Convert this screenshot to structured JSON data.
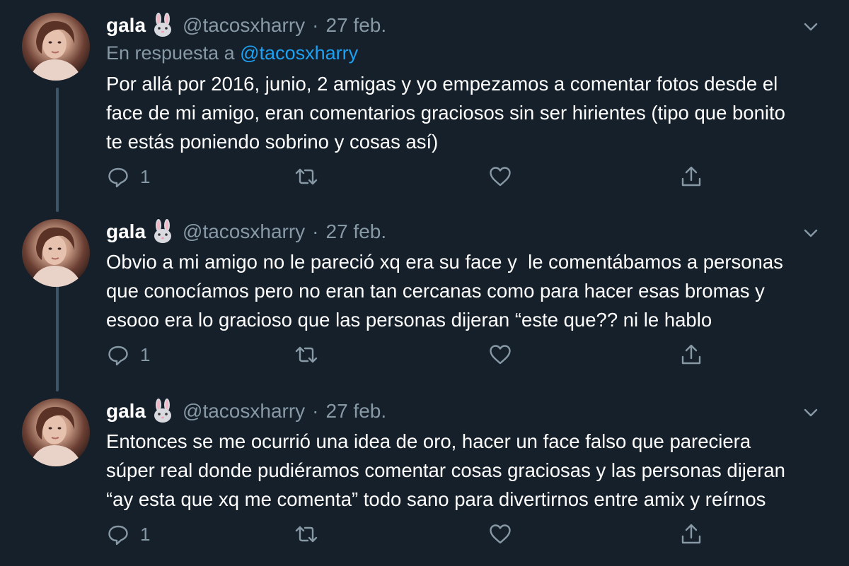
{
  "tweets": [
    {
      "name": "gala",
      "name_emoji": "rabbit-face",
      "handle": "@tacosxharry",
      "separator": "·",
      "date": "27 feb.",
      "reply_prefix": "En respuesta a",
      "reply_mention": "@tacosxharry",
      "text": "Por allá por 2016, junio, 2 amigas y yo empezamos a comentar fotos desde el\nface de mi amigo, eran comentarios graciosos sin ser hirientes (tipo que bonito\nte estás poniendo sobrino y cosas así)",
      "reply_count": "1"
    },
    {
      "name": "gala",
      "name_emoji": "rabbit-face",
      "handle": "@tacosxharry",
      "separator": "·",
      "date": "27 feb.",
      "text": "Obvio a mi amigo no le pareció xq era su face y  le comentábamos a personas\nque conocíamos pero no eran tan cercanas como para hacer esas bromas y\nesooo era lo gracioso que las personas dijeran “este que?? ni le hablo",
      "reply_count": "1"
    },
    {
      "name": "gala",
      "name_emoji": "rabbit-face",
      "handle": "@tacosxharry",
      "separator": "·",
      "date": "27 feb.",
      "text": "Entonces se me ocurrió una idea de oro, hacer un face falso que pareciera\nsúper real donde pudiéramos comentar cosas graciosas y las personas dijeran\n“ay esta que xq me comenta” todo sano para divertirnos entre amix y reírnos",
      "reply_count": "1"
    }
  ],
  "icons": {
    "reply": "reply-icon",
    "retweet": "retweet-icon",
    "like": "heart-icon",
    "share": "share-icon",
    "more": "chevron-down-icon"
  },
  "colors": {
    "background": "#15202b",
    "secondary_text": "#8899a6",
    "link": "#1da1f2",
    "thread_line": "#3d5466"
  }
}
